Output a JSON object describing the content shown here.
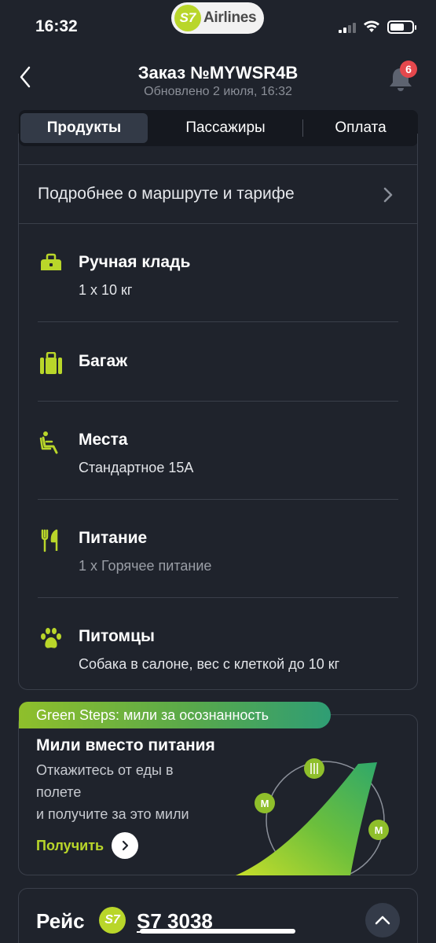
{
  "status_bar": {
    "time": "16:32",
    "brand_logo": "S7",
    "brand_name": "Airlines"
  },
  "header": {
    "title": "Заказ №MYWSR4B",
    "subtitle": "Обновлено 2 июля, 16:32",
    "notification_count": "6",
    "back_icon": "chevron-left-icon",
    "bell_icon": "bell-icon"
  },
  "tabs": [
    {
      "label": "Продукты",
      "active": true
    },
    {
      "label": "Пассажиры",
      "active": false
    },
    {
      "label": "Оплата",
      "active": false
    }
  ],
  "products": {
    "route_link": "Подробнее о маршруте и тарифе",
    "items": [
      {
        "icon": "hand-luggage-icon",
        "title": "Ручная кладь",
        "subtitle": "1 x 10 кг"
      },
      {
        "icon": "suitcase-icon",
        "title": "Багаж",
        "subtitle": ""
      },
      {
        "icon": "seat-icon",
        "title": "Места",
        "subtitle": "Стандартное 15A"
      },
      {
        "icon": "fork-knife-icon",
        "title": "Питание",
        "subtitle": "1 x Горячее питание"
      },
      {
        "icon": "paw-icon",
        "title": "Питомцы",
        "subtitle": "Собака в салоне, вес с клеткой до 10 кг"
      }
    ]
  },
  "promo": {
    "tag": "Green Steps: мили за осознанность",
    "title": "Мили вместо питания",
    "text_lines": [
      "Откажитесь от еды в",
      "полете",
      "и получите за это мили"
    ],
    "action_label": "Получить"
  },
  "flight": {
    "label": "Рейс",
    "logo": "S7",
    "number": "S7 3038"
  },
  "colors": {
    "background": "#1f232c",
    "accent": "#b9d62a",
    "card_border": "#3a3f4a",
    "badge": "#e5484d"
  }
}
